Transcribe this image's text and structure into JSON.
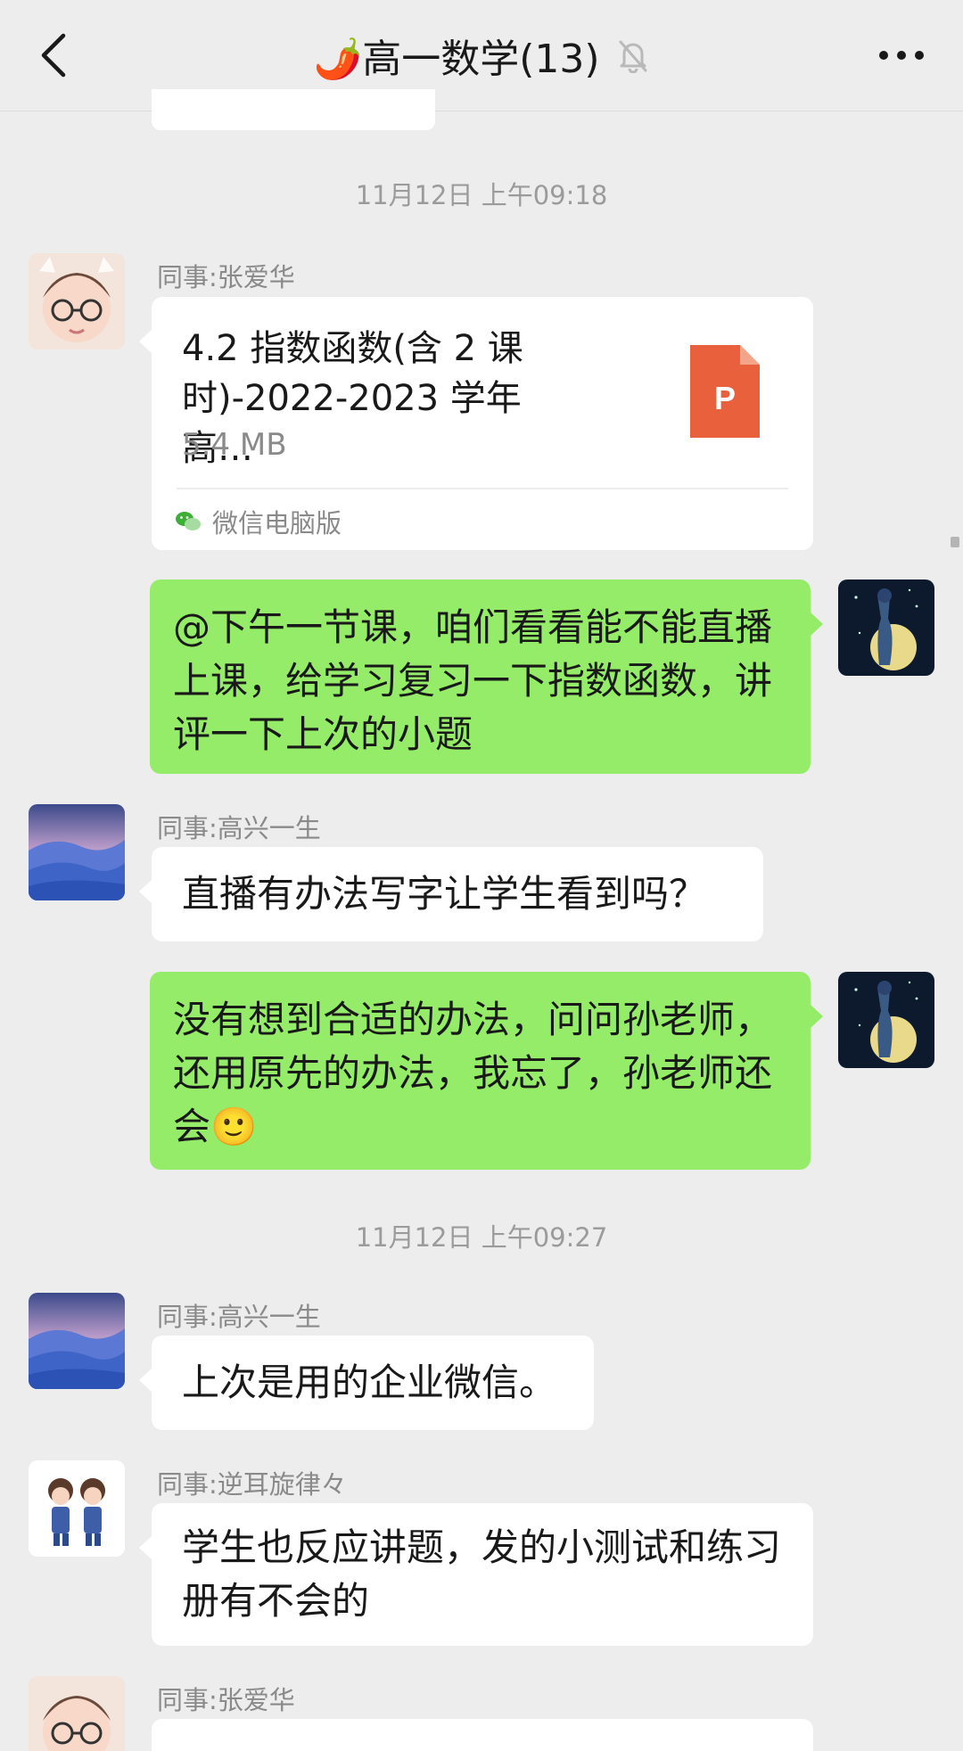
{
  "header": {
    "title": "🌶️高一数学(13)",
    "back_icon": "chevron-left-icon",
    "mute_icon": "bell-off-icon",
    "more_icon": "more-dots-icon"
  },
  "timestamps": [
    "11月12日 上午09:18",
    "11月12日 上午09:27"
  ],
  "messages": [
    {
      "type": "file",
      "sender": "同事:张爱华",
      "file_name": "4.2 指数函数(含 2 课时)-2022-2023 学年高…",
      "file_size": "5.4 MB",
      "file_icon_letter": "P",
      "source": "微信电脑版"
    },
    {
      "type": "text",
      "self": true,
      "text": "@下午一节课，咱们看看能不能直播上课，给学习复习一下指数函数，讲评一下上次的小题"
    },
    {
      "type": "text",
      "sender": "同事:高兴一生",
      "text": "直播有办法写字让学生看到吗？"
    },
    {
      "type": "text",
      "self": true,
      "text": "没有想到合适的办法，问问孙老师，还用原先的办法，我忘了，孙老师还会🙂"
    },
    {
      "type": "text",
      "sender": "同事:高兴一生",
      "text": "上次是用的企业微信。"
    },
    {
      "type": "text",
      "sender": "同事:逆耳旋律々",
      "text": "学生也反应讲题，发的小测试和练习册有不会的"
    },
    {
      "type": "partial",
      "sender": "同事:张爱华"
    }
  ],
  "colors": {
    "background": "#ededed",
    "bubble_self": "#95ec69",
    "bubble_other": "#ffffff",
    "ppt_icon": "#e8603c"
  }
}
